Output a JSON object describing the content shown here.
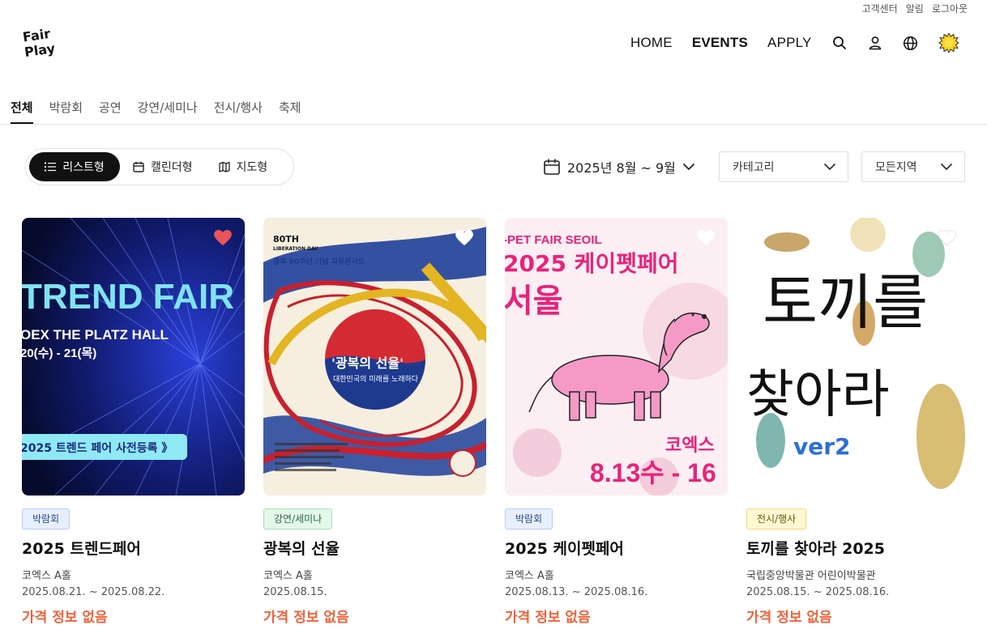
{
  "utility": {
    "help": "고객센터",
    "alerts": "알림",
    "logout": "로그아웃"
  },
  "brand": {
    "logo_line1": "Fair",
    "logo_line2": "Play"
  },
  "nav": {
    "home": "HOME",
    "events": "EVENTS",
    "apply": "APPLY"
  },
  "tabs": [
    {
      "label": "전체",
      "active": true
    },
    {
      "label": "박람회"
    },
    {
      "label": "공연"
    },
    {
      "label": "강연/세미나"
    },
    {
      "label": "전시/행사"
    },
    {
      "label": "축제"
    }
  ],
  "view_toggle": {
    "list": "리스트형",
    "calendar": "캘린더형",
    "map": "지도형",
    "selected": "list"
  },
  "filters": {
    "date_range": "2025년 8월 ~ 9월",
    "category": "카테고리",
    "region": "모든지역"
  },
  "colors": {
    "accent": "#f0623a",
    "heart_active": "#e8545a"
  },
  "events": [
    {
      "category": "박람회",
      "title": "2025 트렌드페어",
      "venue": "코엑스 A홀",
      "dates": "2025.08.21. ~ 2025.08.22.",
      "price": "가격 정보 없음",
      "liked": true,
      "poster": {
        "l1": "TREND FAIR",
        "l2": "OEX THE PLATZ HALL",
        "l3": "20(수) - 21(목)",
        "l4": "2025 트렌드 페어 사전등록  》"
      }
    },
    {
      "category": "강연/세미나",
      "title": "광복의 선율",
      "venue": "코엑스 A홀",
      "dates": "2025.08.15.",
      "price": "가격 정보 없음",
      "liked": false,
      "poster": {
        "l1": "80TH",
        "l2": "LIBERATION DAY",
        "l3": "광복 80주년 기념 자유콘서트",
        "l4": "'광복의 선율'",
        "l5": "대한민국의 미래를 노래하다"
      }
    },
    {
      "category": "박람회",
      "title": "2025 케이펫페어",
      "venue": "코엑스 A홀",
      "dates": "2025.08.13. ~ 2025.08.16.",
      "price": "가격 정보 없음",
      "liked": false,
      "poster": {
        "l1": "-PET FAIR SEOIL",
        "l2": "2025 케이펫페어",
        "l3": "서울",
        "l4": "코엑스",
        "l5": "8.13수 - 16"
      }
    },
    {
      "category": "전시/행사",
      "title": "토끼를 찾아라 2025",
      "venue": "국립중앙박물관 어린이박물관",
      "dates": "2025.08.15. ~ 2025.08.16.",
      "price": "가격 정보 없음",
      "liked": false,
      "poster": {
        "l1": "토끼를",
        "l2": "찾아라",
        "l3": "ver2"
      }
    }
  ]
}
